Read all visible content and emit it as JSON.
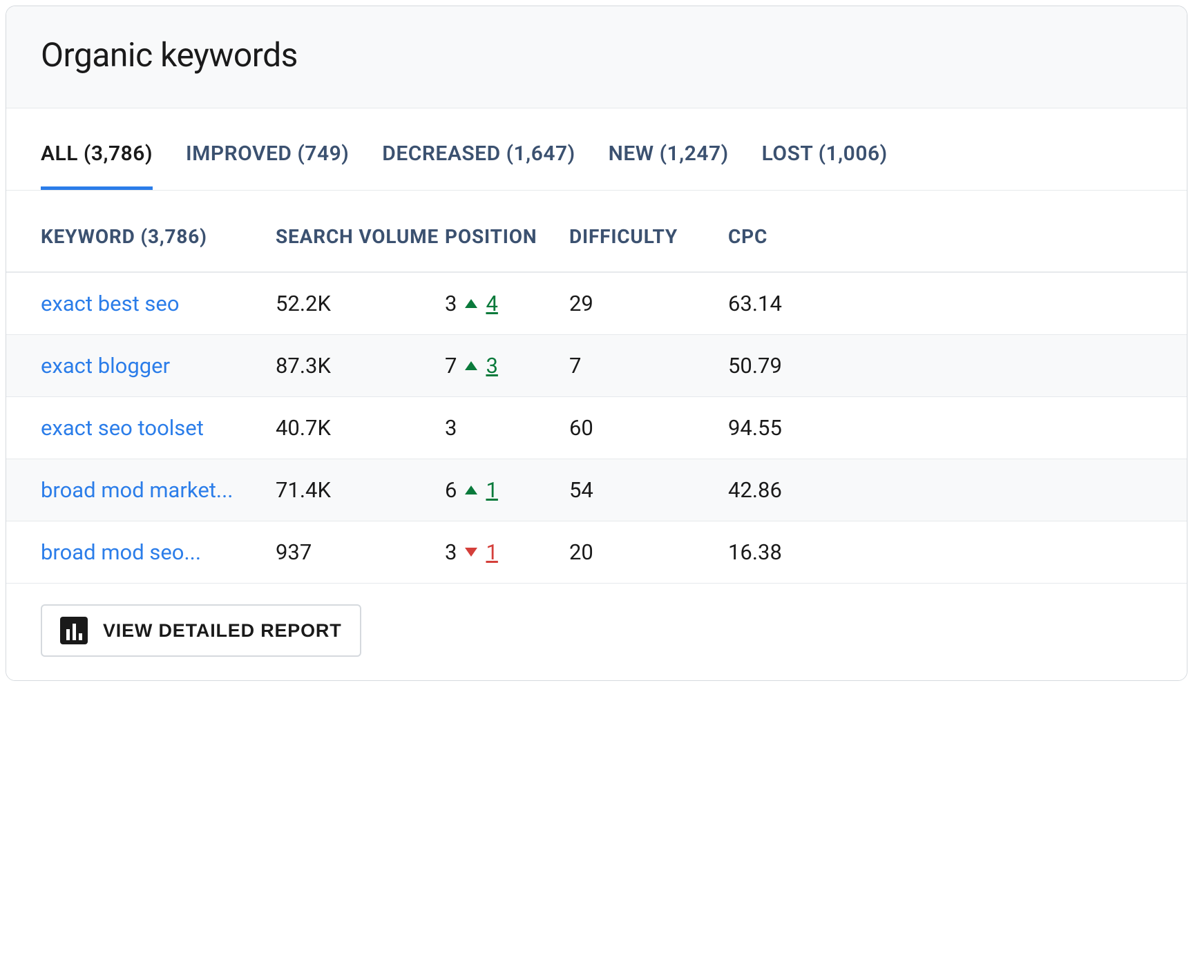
{
  "header": {
    "title": "Organic keywords"
  },
  "tabs": [
    {
      "label": "ALL (3,786)",
      "active": true
    },
    {
      "label": "IMPROVED (749)",
      "active": false
    },
    {
      "label": "DECREASED (1,647)",
      "active": false
    },
    {
      "label": "NEW (1,247)",
      "active": false
    },
    {
      "label": "LOST (1,006)",
      "active": false
    }
  ],
  "table": {
    "columns": {
      "keyword": "KEYWORD (3,786)",
      "search_volume": "SEARCH VOLUME",
      "position": "POSITION",
      "difficulty": "DIFFICULTY",
      "cpc": "CPC"
    },
    "rows": [
      {
        "keyword": "exact best seo",
        "search_volume": "52.2K",
        "position": "3",
        "delta": {
          "direction": "up",
          "value": "4"
        },
        "difficulty": "29",
        "cpc": "63.14"
      },
      {
        "keyword": "exact blogger",
        "search_volume": "87.3K",
        "position": "7",
        "delta": {
          "direction": "up",
          "value": "3"
        },
        "difficulty": "7",
        "cpc": "50.79"
      },
      {
        "keyword": "exact seo toolset",
        "search_volume": "40.7K",
        "position": "3",
        "delta": null,
        "difficulty": "60",
        "cpc": "94.55"
      },
      {
        "keyword": "broad mod market...",
        "search_volume": "71.4K",
        "position": "6",
        "delta": {
          "direction": "up",
          "value": "1"
        },
        "difficulty": "54",
        "cpc": "42.86"
      },
      {
        "keyword": "broad mod seo...",
        "search_volume": "937",
        "position": "3",
        "delta": {
          "direction": "down",
          "value": "1"
        },
        "difficulty": "20",
        "cpc": "16.38"
      }
    ]
  },
  "footer": {
    "report_button_label": "VIEW DETAILED REPORT"
  }
}
